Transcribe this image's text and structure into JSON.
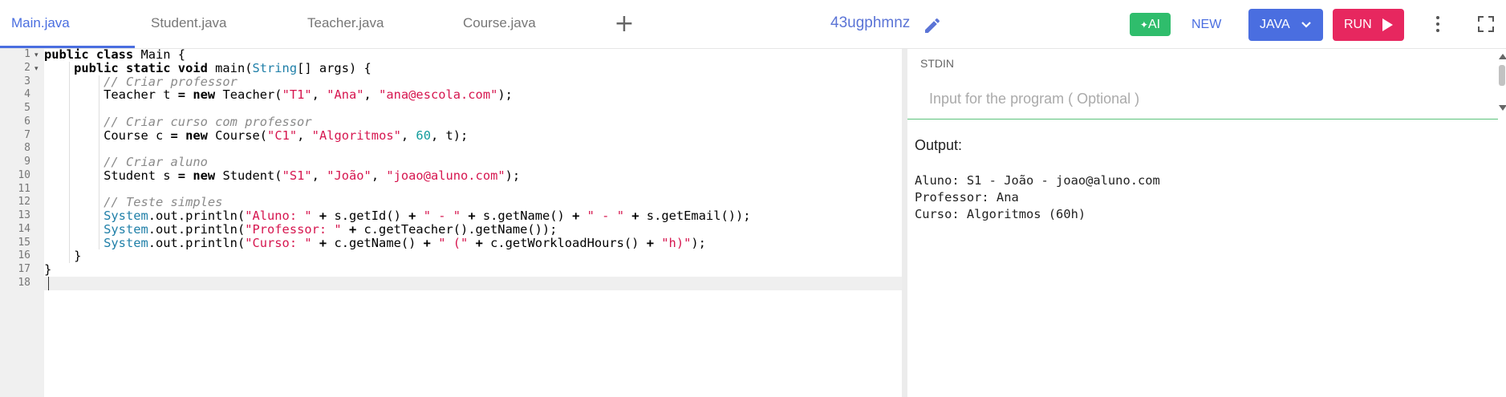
{
  "tabs": [
    {
      "label": "Main.java",
      "active": true
    },
    {
      "label": "Student.java",
      "active": false
    },
    {
      "label": "Teacher.java",
      "active": false
    },
    {
      "label": "Course.java",
      "active": false
    }
  ],
  "toolbar": {
    "add_tab_icon": "plus-icon",
    "project_name": "43ugphmnz",
    "edit_icon": "pencil-icon",
    "ai_label": "AI",
    "new_label": "NEW",
    "language_label": "JAVA",
    "run_label": "RUN",
    "more_icon": "kebab-icon",
    "fullscreen_icon": "fullscreen-icon"
  },
  "colors": {
    "accent": "#4a6ee0",
    "run": "#e7275f",
    "ai": "#2fbd6c",
    "string": "#d6164f",
    "type": "#1f7fa8",
    "comment": "#8a8a8a",
    "number": "#129c9c"
  },
  "editor": {
    "active_line": 18,
    "lines": [
      [
        {
          "t": "public class",
          "c": "kw"
        },
        {
          "t": " Main {"
        }
      ],
      [
        {
          "t": "    "
        },
        {
          "t": "public static void",
          "c": "kw"
        },
        {
          "t": " main("
        },
        {
          "t": "String",
          "c": "ty"
        },
        {
          "t": "[] args) {"
        }
      ],
      [
        {
          "t": "        "
        },
        {
          "t": "// Criar professor",
          "c": "cm"
        }
      ],
      [
        {
          "t": "        Teacher t "
        },
        {
          "t": "=",
          "c": "kw"
        },
        {
          "t": " "
        },
        {
          "t": "new",
          "c": "kw"
        },
        {
          "t": " Teacher("
        },
        {
          "t": "\"T1\"",
          "c": "str"
        },
        {
          "t": ", "
        },
        {
          "t": "\"Ana\"",
          "c": "str"
        },
        {
          "t": ", "
        },
        {
          "t": "\"ana@escola.com\"",
          "c": "str"
        },
        {
          "t": ");"
        }
      ],
      [],
      [
        {
          "t": "        "
        },
        {
          "t": "// Criar curso com professor",
          "c": "cm"
        }
      ],
      [
        {
          "t": "        Course c "
        },
        {
          "t": "=",
          "c": "kw"
        },
        {
          "t": " "
        },
        {
          "t": "new",
          "c": "kw"
        },
        {
          "t": " Course("
        },
        {
          "t": "\"C1\"",
          "c": "str"
        },
        {
          "t": ", "
        },
        {
          "t": "\"Algoritmos\"",
          "c": "str"
        },
        {
          "t": ", "
        },
        {
          "t": "60",
          "c": "num"
        },
        {
          "t": ", t);"
        }
      ],
      [],
      [
        {
          "t": "        "
        },
        {
          "t": "// Criar aluno",
          "c": "cm"
        }
      ],
      [
        {
          "t": "        Student s "
        },
        {
          "t": "=",
          "c": "kw"
        },
        {
          "t": " "
        },
        {
          "t": "new",
          "c": "kw"
        },
        {
          "t": " Student("
        },
        {
          "t": "\"S1\"",
          "c": "str"
        },
        {
          "t": ", "
        },
        {
          "t": "\"João\"",
          "c": "str"
        },
        {
          "t": ", "
        },
        {
          "t": "\"joao@aluno.com\"",
          "c": "str"
        },
        {
          "t": ");"
        }
      ],
      [],
      [
        {
          "t": "        "
        },
        {
          "t": "// Teste simples",
          "c": "cm"
        }
      ],
      [
        {
          "t": "        "
        },
        {
          "t": "System",
          "c": "ty"
        },
        {
          "t": ".out.println("
        },
        {
          "t": "\"Aluno: \"",
          "c": "str"
        },
        {
          "t": " "
        },
        {
          "t": "+",
          "c": "kw"
        },
        {
          "t": " s.getId() "
        },
        {
          "t": "+",
          "c": "kw"
        },
        {
          "t": " "
        },
        {
          "t": "\" - \"",
          "c": "str"
        },
        {
          "t": " "
        },
        {
          "t": "+",
          "c": "kw"
        },
        {
          "t": " s.getName() "
        },
        {
          "t": "+",
          "c": "kw"
        },
        {
          "t": " "
        },
        {
          "t": "\" - \"",
          "c": "str"
        },
        {
          "t": " "
        },
        {
          "t": "+",
          "c": "kw"
        },
        {
          "t": " s.getEmail());"
        }
      ],
      [
        {
          "t": "        "
        },
        {
          "t": "System",
          "c": "ty"
        },
        {
          "t": ".out.println("
        },
        {
          "t": "\"Professor: \"",
          "c": "str"
        },
        {
          "t": " "
        },
        {
          "t": "+",
          "c": "kw"
        },
        {
          "t": " c.getTeacher().getName());"
        }
      ],
      [
        {
          "t": "        "
        },
        {
          "t": "System",
          "c": "ty"
        },
        {
          "t": ".out.println("
        },
        {
          "t": "\"Curso: \"",
          "c": "str"
        },
        {
          "t": " "
        },
        {
          "t": "+",
          "c": "kw"
        },
        {
          "t": " c.getName() "
        },
        {
          "t": "+",
          "c": "kw"
        },
        {
          "t": " "
        },
        {
          "t": "\" (\"",
          "c": "str"
        },
        {
          "t": " "
        },
        {
          "t": "+",
          "c": "kw"
        },
        {
          "t": " c.getWorkloadHours() "
        },
        {
          "t": "+",
          "c": "kw"
        },
        {
          "t": " "
        },
        {
          "t": "\"h)\"",
          "c": "str"
        },
        {
          "t": ");"
        }
      ],
      [
        {
          "t": "    }"
        }
      ],
      [
        {
          "t": "}"
        }
      ],
      []
    ]
  },
  "stdin": {
    "label": "STDIN",
    "placeholder": "Input for the program ( Optional )",
    "value": ""
  },
  "output": {
    "label": "Output:",
    "lines": [
      "Aluno: S1 - João - joao@aluno.com",
      "Professor: Ana",
      "Curso: Algoritmos (60h)"
    ]
  }
}
